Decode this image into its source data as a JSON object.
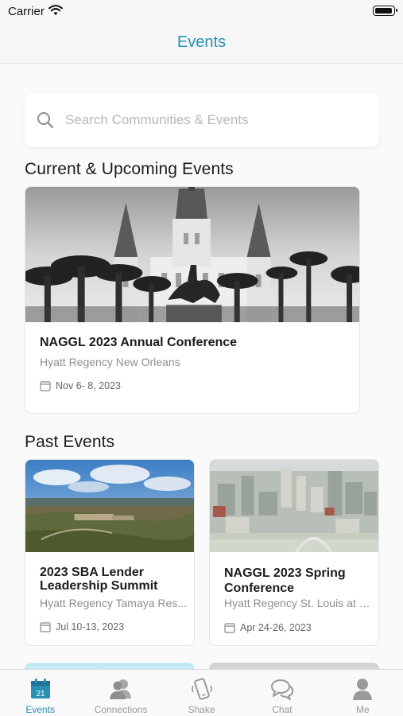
{
  "status_bar": {
    "carrier": "Carrier"
  },
  "nav": {
    "title": "Events"
  },
  "search": {
    "placeholder": "Search Communities & Events"
  },
  "current_section": {
    "title": "Current & Upcoming Events",
    "events": [
      {
        "title": "NAGGL 2023 Annual Conference",
        "venue": "Hyatt Regency New Orleans",
        "date": "Nov  6- 8, 2023",
        "image": "cathedral-photo"
      }
    ]
  },
  "past_section": {
    "title": "Past Events",
    "events": [
      {
        "title": "2023 SBA Lender Leadership Summit",
        "venue": "Hyatt Regency Tamaya Res...",
        "date": "Jul 10-13, 2023",
        "image": "resort-landscape-photo"
      },
      {
        "title": "NAGGL 2023 Spring Conference",
        "venue": "Hyatt Regency St. Louis at t...",
        "date": "Apr 24-26, 2023",
        "image": "city-aerial-photo"
      }
    ]
  },
  "tab_bar": {
    "tabs": [
      {
        "label": "Events",
        "icon": "calendar-icon",
        "active": true,
        "badge": "21"
      },
      {
        "label": "Connections",
        "icon": "people-icon",
        "active": false
      },
      {
        "label": "Shake",
        "icon": "shake-phone-icon",
        "active": false
      },
      {
        "label": "Chat",
        "icon": "chat-bubbles-icon",
        "active": false
      },
      {
        "label": "Me",
        "icon": "person-icon",
        "active": false
      }
    ]
  },
  "colors": {
    "accent": "#2a8fb5",
    "placeholder": "#b7b7bb",
    "secondary_text": "#8e8e93"
  }
}
